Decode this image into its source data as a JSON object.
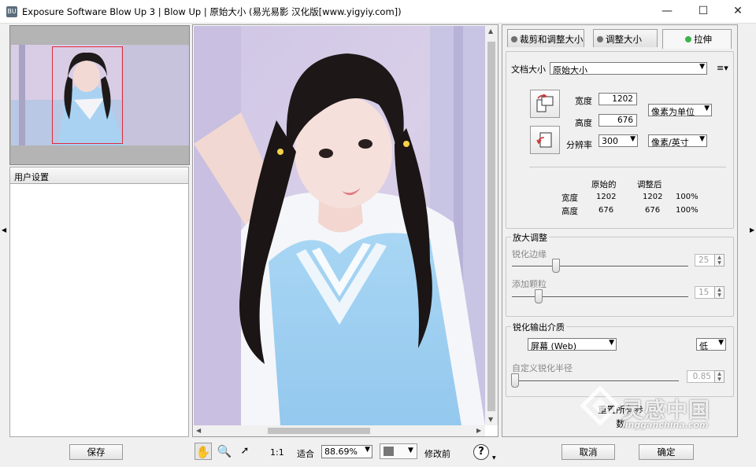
{
  "window": {
    "title": "Exposure Software Blow Up 3 | Blow Up | 原始大小   (易光易影 汉化版[www.yigyiy.com])",
    "minimize_glyph": "—",
    "maximize_glyph": "☐",
    "close_glyph": "✕"
  },
  "left_panel": {
    "user_settings_label": "用户设置",
    "save_button": "保存"
  },
  "tabs": [
    {
      "label": "裁剪和调整大小",
      "active": false,
      "dot_color": "#707070"
    },
    {
      "label": "调整大小",
      "active": false,
      "dot_color": "#707070"
    },
    {
      "label": "拉伸",
      "active": true,
      "dot_color": "#3cb44b"
    }
  ],
  "doc_size": {
    "label": "文档大小",
    "value": "原始大小",
    "menu_icon": "≡▾"
  },
  "dimensions": {
    "width_label": "宽度",
    "width_value": "1202",
    "height_label": "高度",
    "height_value": "676",
    "unit_value": "像素为单位",
    "resolution_label": "分辨率",
    "resolution_value": "300",
    "resolution_unit": "像素/英寸"
  },
  "compare": {
    "col_original": "原始的",
    "col_adjusted": "调整后",
    "rows": [
      {
        "label": "宽度",
        "original": "1202",
        "adjusted": "1202",
        "percent": "100%"
      },
      {
        "label": "高度",
        "original": "676",
        "adjusted": "676",
        "percent": "100%"
      }
    ]
  },
  "enlarge": {
    "group_label": "放大调整",
    "sharpen_edges_label": "锐化边缘",
    "sharpen_edges_value": "25",
    "sharpen_edges_fraction": 0.25,
    "add_grain_label": "添加颗粒",
    "add_grain_value": "15",
    "add_grain_fraction": 0.15
  },
  "output_sharpen": {
    "group_label": "锐化输出介质",
    "medium_value": "屏幕 (Web)",
    "amount_value": "低",
    "custom_radius_label": "自定义锐化半径",
    "custom_radius_value": "0.85",
    "custom_radius_fraction": 0.02
  },
  "reset_button": "重置所有参数",
  "bottom": {
    "ratio_label": "1:1",
    "fit_label": "适合",
    "zoom_value": "88.69%",
    "modify_label": "修改前",
    "help_glyph": "?",
    "cancel_button": "取消",
    "ok_button": "确定"
  },
  "watermark": {
    "text": "灵感中国",
    "url": "lingganchina.com"
  },
  "colors": {
    "selection_rect": "#e0283a",
    "active_dot": "#3cb44b"
  }
}
